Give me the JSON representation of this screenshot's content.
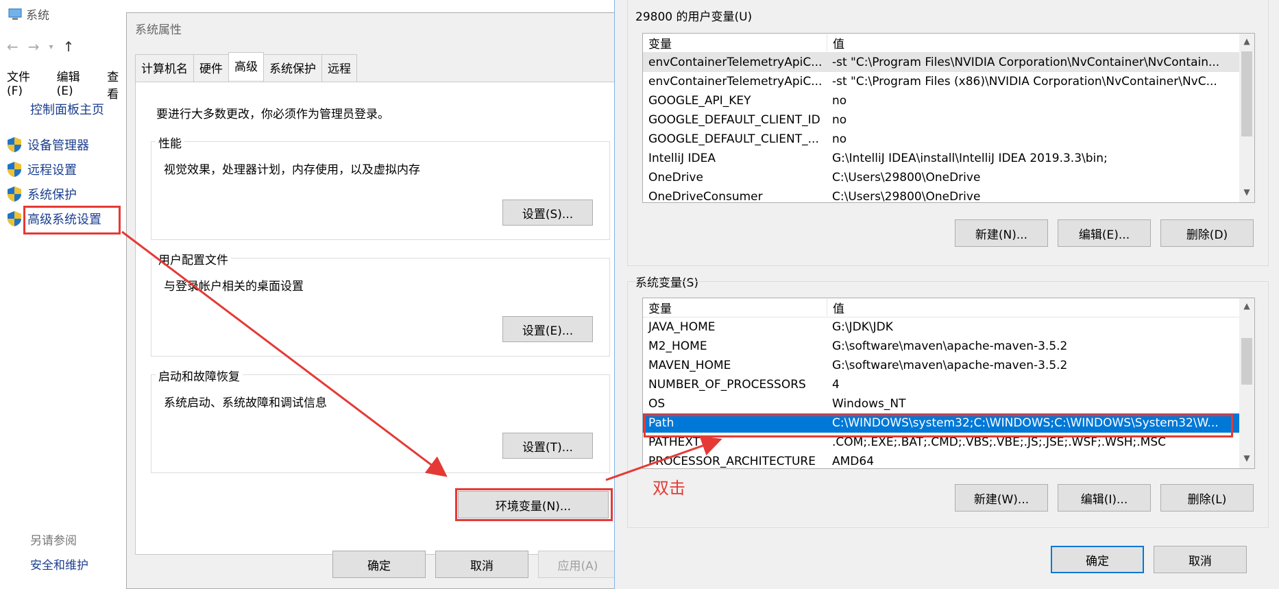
{
  "control_panel": {
    "title": "系统",
    "menu": [
      "文件(F)",
      "编辑(E)",
      "查看"
    ],
    "home_link": "控制面板主页",
    "items": [
      {
        "label": "设备管理器"
      },
      {
        "label": "远程设置"
      },
      {
        "label": "系统保护"
      },
      {
        "label": "高级系统设置"
      }
    ],
    "see_also": "另请参阅",
    "security_link": "安全和维护"
  },
  "system_properties": {
    "title": "系统属性",
    "tabs": [
      "计算机名",
      "硬件",
      "高级",
      "系统保护",
      "远程"
    ],
    "active_tab": "高级",
    "admin_note": "要进行大多数更改，你必须作为管理员登录。",
    "performance": {
      "label": "性能",
      "desc": "视觉效果，处理器计划，内存使用，以及虚拟内存",
      "button": "设置(S)..."
    },
    "profiles": {
      "label": "用户配置文件",
      "desc": "与登录帐户相关的桌面设置",
      "button": "设置(E)..."
    },
    "startup": {
      "label": "启动和故障恢复",
      "desc": "系统启动、系统故障和调试信息",
      "button": "设置(T)..."
    },
    "env_button": "环境变量(N)...",
    "ok": "确定",
    "cancel": "取消",
    "apply": "应用(A)"
  },
  "env_vars": {
    "user_section": "29800 的用户变量(U)",
    "col_var": "变量",
    "col_val": "值",
    "user_vars": [
      {
        "name": "envContainerTelemetryApiC...",
        "value": "-st \"C:\\Program Files\\NVIDIA Corporation\\NvContainer\\NvContain..."
      },
      {
        "name": "envContainerTelemetryApiC...",
        "value": "-st \"C:\\Program Files (x86)\\NVIDIA Corporation\\NvContainer\\NvC..."
      },
      {
        "name": "GOOGLE_API_KEY",
        "value": "no"
      },
      {
        "name": "GOOGLE_DEFAULT_CLIENT_ID",
        "value": "no"
      },
      {
        "name": "GOOGLE_DEFAULT_CLIENT_...",
        "value": "no"
      },
      {
        "name": "IntelliJ IDEA",
        "value": "G:\\IntelliJ IDEA\\install\\IntelliJ IDEA 2019.3.3\\bin;"
      },
      {
        "name": "OneDrive",
        "value": "C:\\Users\\29800\\OneDrive"
      },
      {
        "name": "OneDriveConsumer",
        "value": "C:\\Users\\29800\\OneDrive"
      }
    ],
    "user_buttons": [
      "新建(N)...",
      "编辑(E)...",
      "删除(D)"
    ],
    "system_section": "系统变量(S)",
    "system_vars": [
      {
        "name": "JAVA_HOME",
        "value": "G:\\JDK\\JDK"
      },
      {
        "name": "M2_HOME",
        "value": "G:\\software\\maven\\apache-maven-3.5.2"
      },
      {
        "name": "MAVEN_HOME",
        "value": "G:\\software\\maven\\apache-maven-3.5.2"
      },
      {
        "name": "NUMBER_OF_PROCESSORS",
        "value": "4"
      },
      {
        "name": "OS",
        "value": "Windows_NT"
      },
      {
        "name": "Path",
        "value": "C:\\WINDOWS\\system32;C:\\WINDOWS;C:\\WINDOWS\\System32\\W..."
      },
      {
        "name": "PATHEXT",
        "value": ".COM;.EXE;.BAT;.CMD;.VBS;.VBE;.JS;.JSE;.WSF;.WSH;.MSC"
      },
      {
        "name": "PROCESSOR_ARCHITECTURE",
        "value": "AMD64"
      }
    ],
    "selected_system_var": "Path",
    "system_buttons": [
      "新建(W)...",
      "编辑(I)...",
      "删除(L)"
    ],
    "ok": "确定",
    "cancel": "取消"
  },
  "annotation": {
    "text": "双击",
    "color": "#e53935"
  }
}
